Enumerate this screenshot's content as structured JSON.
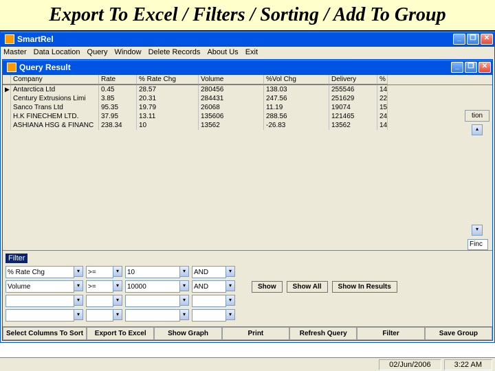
{
  "banner": {
    "title": "Export To Excel / Filters / Sorting / Add To Group"
  },
  "outer": {
    "title": "SmartRel",
    "menu": [
      "Master",
      "Data Location",
      "Query",
      "Window",
      "Delete Records",
      "About Us",
      "Exit"
    ]
  },
  "inner": {
    "title": "Query Result"
  },
  "grid": {
    "row_indicator": "▶",
    "headers": [
      "Company",
      "Rate",
      "% Rate Chg",
      "Volume",
      "%Vol Chg",
      "Delivery",
      "%"
    ],
    "rows": [
      [
        "Antarctica Ltd",
        "0.45",
        "28.57",
        "280456",
        "138.03",
        "255546",
        "14"
      ],
      [
        "Century Extrusions Limi",
        "3.85",
        "20.31",
        "284431",
        "247.56",
        "251629",
        "22"
      ],
      [
        "Sanco Trans Ltd",
        "95.35",
        "19.79",
        "26068",
        "11.19",
        "19074",
        "15"
      ],
      [
        "H.K FINECHEM LTD.",
        "37.95",
        "13.11",
        "135606",
        "288.56",
        "121465",
        "24"
      ],
      [
        "ASHIANA HSG & FINANC",
        "238.34",
        "10",
        "13562",
        "-26.83",
        "13562",
        "14"
      ]
    ]
  },
  "filter": {
    "label": "Filter",
    "rows": [
      {
        "field": "% Rate Chg",
        "op": ">=",
        "val": "10",
        "logic": "AND"
      },
      {
        "field": "Volume",
        "op": ">=",
        "val": "10000",
        "logic": "AND"
      },
      {
        "field": "",
        "op": "",
        "val": "",
        "logic": ""
      },
      {
        "field": "",
        "op": "",
        "val": "",
        "logic": ""
      }
    ],
    "buttons": {
      "show": "Show",
      "showall": "Show All",
      "showin": "Show In Results"
    }
  },
  "toolbar": {
    "sortcols": "Select Columns To Sort",
    "export": "Export To Excel",
    "graph": "Show Graph",
    "print": "Print",
    "refresh": "Refresh Query",
    "filter": "Filter",
    "savegroup": "Save Group"
  },
  "right": {
    "label": "tion",
    "find": "Finc"
  },
  "status": {
    "date": "02/Jun/2006",
    "time": "3:22 AM"
  },
  "dd_glyph": "▾",
  "scroll_up": "▴",
  "scroll_down": "▾"
}
